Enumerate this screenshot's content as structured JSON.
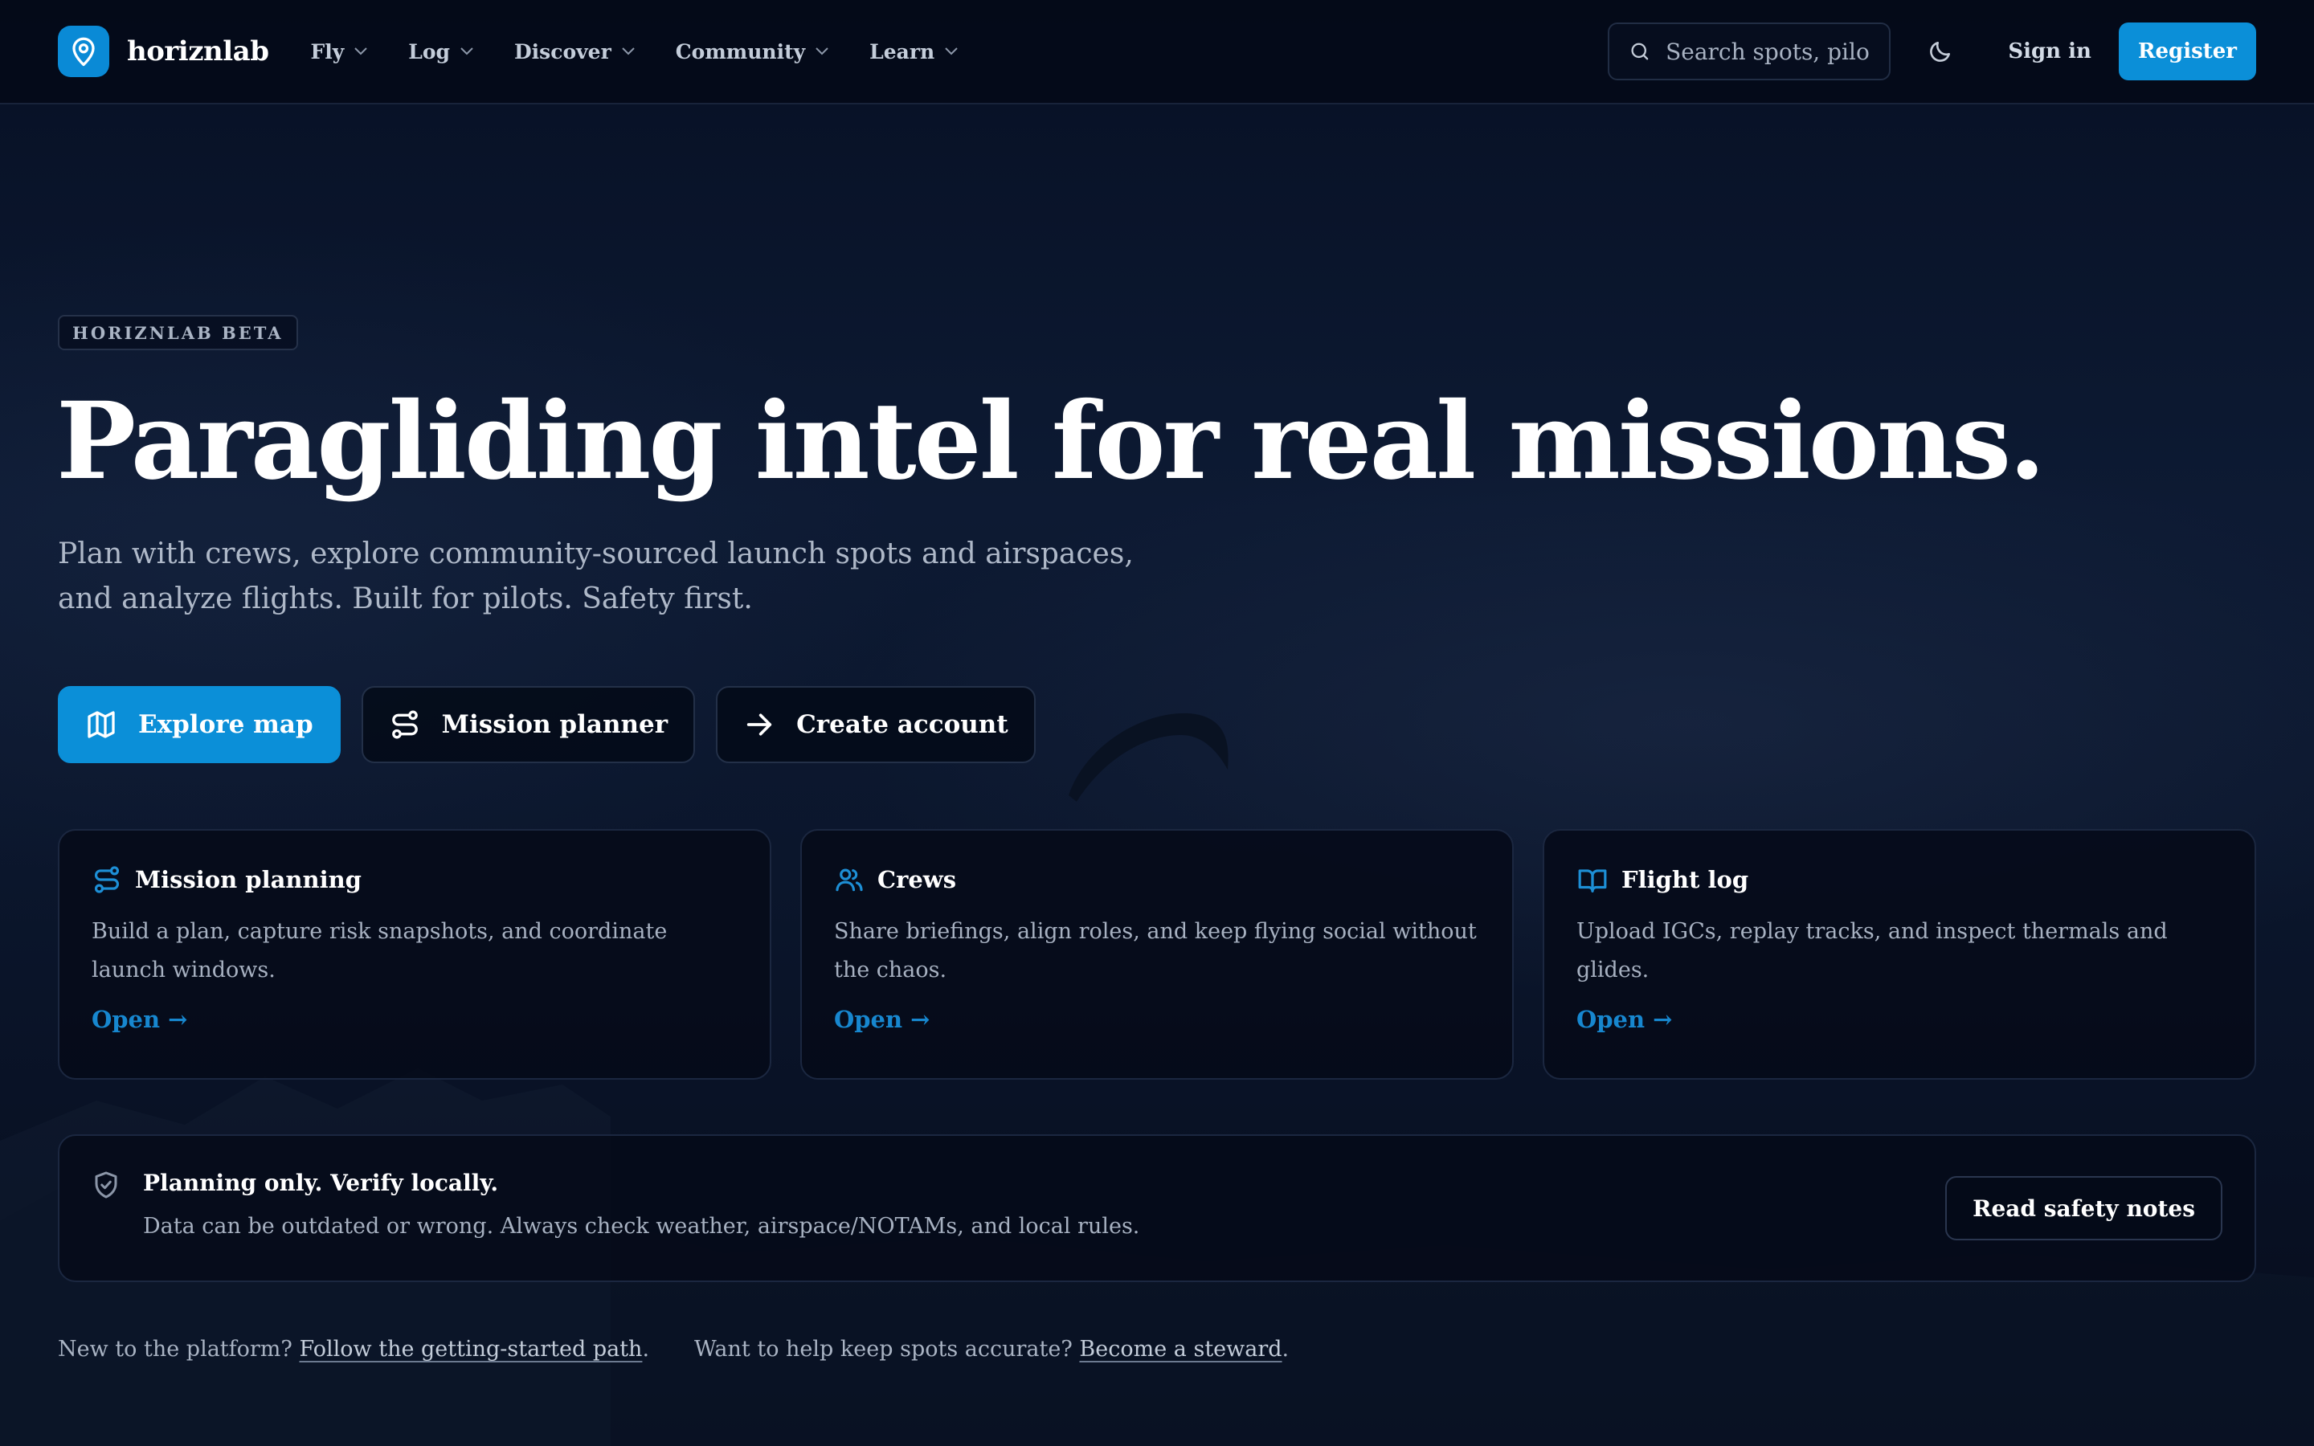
{
  "brand": {
    "name": "horiznlab",
    "accent": "#0b8fd8"
  },
  "nav": {
    "menu": [
      {
        "label": "Fly"
      },
      {
        "label": "Log"
      },
      {
        "label": "Discover"
      },
      {
        "label": "Community"
      },
      {
        "label": "Learn"
      }
    ],
    "search_placeholder": "Search spots, pilot…",
    "theme_icon": "moon-icon",
    "sign_in": "Sign in",
    "register": "Register"
  },
  "hero": {
    "badge": "HORIZNLAB BETA",
    "title": "Paragliding intel for real missions.",
    "subtitle": "Plan with crews, explore community-sourced launch spots and airspaces, and analyze flights. Built for pilots. Safety first.",
    "ctas": [
      {
        "label": "Explore map",
        "icon": "map-icon"
      },
      {
        "label": "Mission planner",
        "icon": "route-icon"
      },
      {
        "label": "Create account",
        "icon": "arrow-right-icon"
      }
    ]
  },
  "cards": [
    {
      "title": "Mission planning",
      "icon": "route-icon",
      "desc": "Build a plan, capture risk snapshots, and coordinate launch windows.",
      "link": "Open →"
    },
    {
      "title": "Crews",
      "icon": "users-icon",
      "desc": "Share briefings, align roles, and keep flying social without the chaos.",
      "link": "Open →"
    },
    {
      "title": "Flight log",
      "icon": "book-open-icon",
      "desc": "Upload IGCs, replay tracks, and inspect thermals and glides.",
      "link": "Open →"
    }
  ],
  "safety": {
    "title": "Planning only. Verify locally.",
    "desc": "Data can be outdated or wrong. Always check weather, airspace/NOTAMs, and local rules.",
    "button": "Read safety notes"
  },
  "footer": {
    "new_prefix": "New to the platform? ",
    "new_link": "Follow the getting-started path",
    "help_prefix": "Want to help keep spots accurate? ",
    "help_link": "Become a steward",
    "period": "."
  }
}
